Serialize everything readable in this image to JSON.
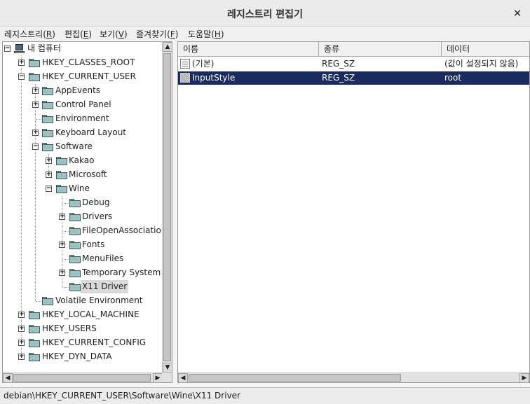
{
  "window": {
    "title": "레지스트리 편집기",
    "close_glyph": "✕"
  },
  "menubar": [
    {
      "label": "레지스트리(",
      "acc": "R",
      "suffix": ")"
    },
    {
      "label": "편집(",
      "acc": "E",
      "suffix": ")"
    },
    {
      "label": "보기(",
      "acc": "V",
      "suffix": ")"
    },
    {
      "label": "즐겨찾기(",
      "acc": "F",
      "suffix": ")"
    },
    {
      "label": "도움말(",
      "acc": "H",
      "suffix": ")"
    }
  ],
  "tree": {
    "root_label": "내 컴퓨터",
    "nodes": [
      {
        "label": "HKEY_CLASSES_ROOT",
        "expander": "+"
      },
      {
        "label": "HKEY_CURRENT_USER",
        "expander": "−"
      },
      {
        "label": "AppEvents",
        "expander": "+"
      },
      {
        "label": "Control Panel",
        "expander": "+"
      },
      {
        "label": "Environment",
        "expander": ""
      },
      {
        "label": "Keyboard Layout",
        "expander": "+"
      },
      {
        "label": "Software",
        "expander": "−"
      },
      {
        "label": "Kakao",
        "expander": "+"
      },
      {
        "label": "Microsoft",
        "expander": "+"
      },
      {
        "label": "Wine",
        "expander": "−"
      },
      {
        "label": "Debug",
        "expander": ""
      },
      {
        "label": "Drivers",
        "expander": "+"
      },
      {
        "label": "FileOpenAssociations",
        "expander": ""
      },
      {
        "label": "Fonts",
        "expander": "+"
      },
      {
        "label": "MenuFiles",
        "expander": ""
      },
      {
        "label": "Temporary System Files",
        "expander": "+"
      },
      {
        "label": "X11 Driver",
        "expander": ""
      },
      {
        "label": "Volatile Environment",
        "expander": ""
      },
      {
        "label": "HKEY_LOCAL_MACHINE",
        "expander": "+"
      },
      {
        "label": "HKEY_USERS",
        "expander": "+"
      },
      {
        "label": "HKEY_CURRENT_CONFIG",
        "expander": "+"
      },
      {
        "label": "HKEY_DYN_DATA",
        "expander": "+"
      }
    ]
  },
  "list": {
    "columns": [
      "이름",
      "종류",
      "데이터"
    ],
    "rows": [
      {
        "name": "(기본)",
        "type": "REG_SZ",
        "data": "(값이 설정되지 않음)"
      },
      {
        "name": "InputStyle",
        "type": "REG_SZ",
        "data": "root"
      }
    ]
  },
  "scroll": {
    "up": "▲",
    "down": "▼",
    "left": "◀",
    "right": "▶"
  },
  "statusbar": {
    "path": "debian\\HKEY_CURRENT_USER\\Software\\Wine\\X11 Driver"
  }
}
